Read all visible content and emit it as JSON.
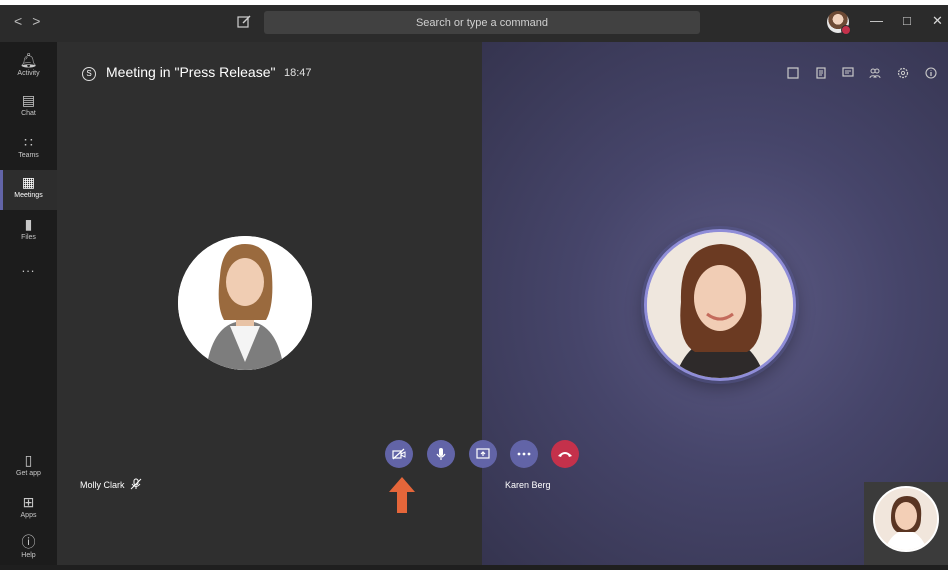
{
  "topbar": {
    "back_label": "<",
    "forward_label": ">",
    "search_placeholder": "Search or type a command",
    "minimize": "—",
    "maximize": "□",
    "close": "✕"
  },
  "rail": {
    "items": [
      {
        "label": "Activity",
        "icon": "bell-icon"
      },
      {
        "label": "Chat",
        "icon": "chat-icon"
      },
      {
        "label": "Teams",
        "icon": "teams-icon"
      },
      {
        "label": "Meetings",
        "icon": "calendar-icon"
      },
      {
        "label": "Files",
        "icon": "file-icon"
      },
      {
        "label": "...",
        "icon": "more-icon"
      }
    ],
    "bottom": [
      {
        "label": "Get app",
        "icon": "phone-icon"
      },
      {
        "label": "Apps",
        "icon": "apps-icon"
      },
      {
        "label": "Help",
        "icon": "help-icon"
      }
    ]
  },
  "meeting": {
    "title": "Meeting in \"Press Release\"",
    "time": "18:47"
  },
  "participants": {
    "left_name": "Molly Clark",
    "right_name": "Karen Berg"
  },
  "controls": {
    "camera": "camera-off-icon",
    "mic": "microphone-icon",
    "share": "share-screen-icon",
    "more": "more-options-icon",
    "hangup": "hang-up-icon"
  },
  "colors": {
    "accent": "#6264a7",
    "hangup": "#c4314b",
    "annotation_arrow": "#e5663a"
  }
}
